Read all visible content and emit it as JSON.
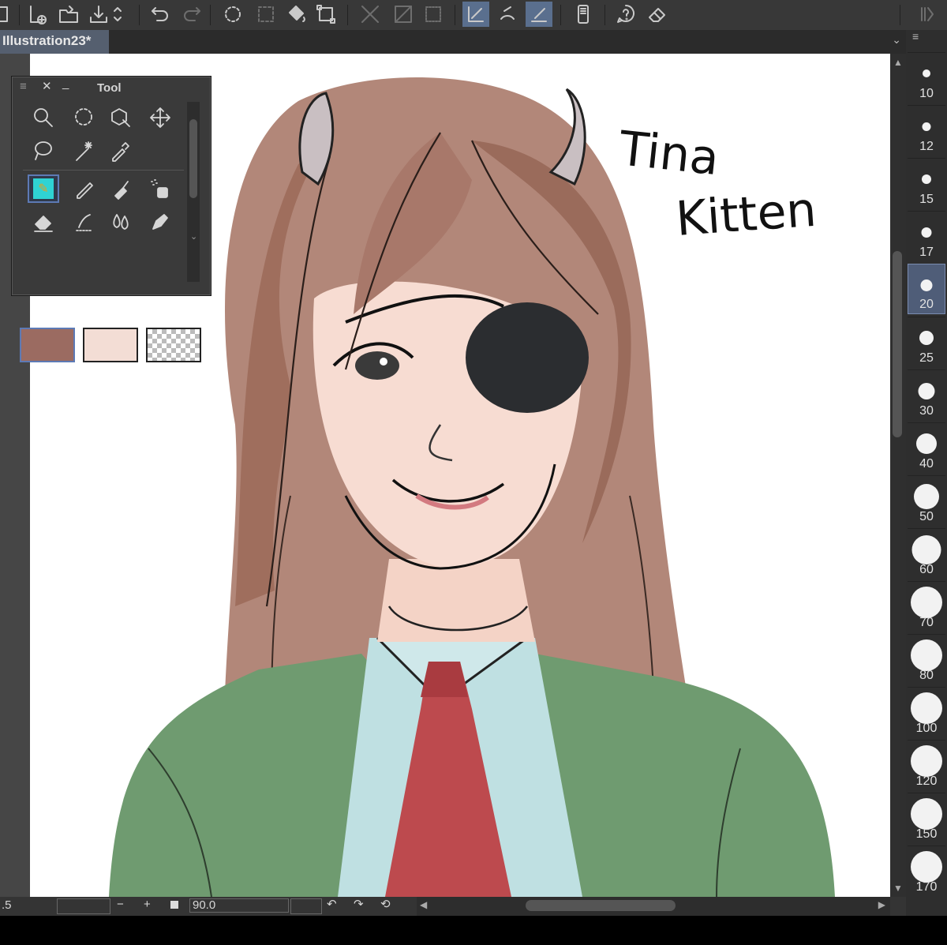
{
  "document": {
    "tab_title": "Illustration23*"
  },
  "tool_palette": {
    "title": "Tool",
    "tools": [
      "zoom-icon",
      "lasso-selection-icon",
      "operation-icon",
      "move-icon",
      "auto-select-icon",
      "magic-wand-icon",
      "eyedropper-icon",
      "pen-icon",
      "pencil-icon",
      "brush-icon",
      "airbrush-icon",
      "eraser-icon",
      "blend-icon",
      "fill-icon",
      "decoration-icon"
    ],
    "selected_tool": "pen-icon",
    "main_color": "#9b6b61",
    "sub_color": "#f3ddd5"
  },
  "canvas_text": {
    "line1": "Tina",
    "line2": "Kitten"
  },
  "brush_sizes": {
    "items": [
      "10",
      "12",
      "15",
      "17",
      "20",
      "25",
      "30",
      "40",
      "50",
      "60",
      "70",
      "80",
      "100",
      "120",
      "150",
      "170"
    ],
    "selected": "20"
  },
  "status": {
    "left_value": ".5",
    "zoom_minus": "−",
    "zoom_plus": "+",
    "angle": "90.0"
  },
  "colors": {
    "accent": "#5d7ab5",
    "hair": "#9b6b57",
    "jacket": "#6e9a6f",
    "tie": "#b9484c",
    "shirt": "#b8dde0"
  }
}
